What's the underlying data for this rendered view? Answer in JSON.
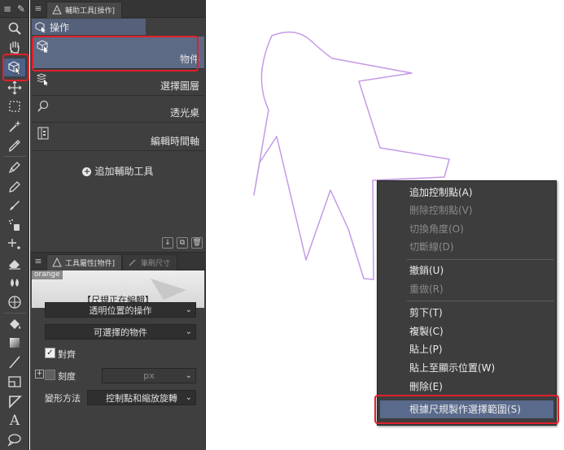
{
  "toolbar": {
    "tools": [
      "zoom-icon",
      "hand-icon",
      "operation-icon",
      "move-layer-icon",
      "selection-icon",
      "auto-select-icon",
      "eyedropper-icon",
      "pen-icon",
      "pencil-icon",
      "brush-icon",
      "airbrush-icon",
      "decoration-icon",
      "eraser-icon",
      "blend-icon",
      "figure-icon",
      "fill-icon",
      "gradient-icon",
      "line-icon",
      "frame-border-icon",
      "ruler-icon",
      "text-icon",
      "balloon-icon"
    ],
    "active_tool": "operation-icon"
  },
  "subtool_panel": {
    "tab_label": "輔助工具[操作]",
    "group_label": "操作",
    "items": [
      {
        "label": "物件",
        "icon": "object-cursor-icon",
        "selected": true
      },
      {
        "label": "選擇圖層",
        "icon": "select-layer-icon",
        "selected": false
      },
      {
        "label": "透光桌",
        "icon": "light-table-icon",
        "selected": false
      },
      {
        "label": "編輯時間軸",
        "icon": "timeline-icon",
        "selected": false
      }
    ],
    "add_label": "追加輔助工具"
  },
  "tool_property": {
    "tab_label": "工具屬性[物件]",
    "tab2_label": "筆刷尺寸",
    "preview_tag": "orange",
    "status_text": "【尺規正在編輯】",
    "transparent_op": "透明位置的操作",
    "selectable_obj": "可選擇的物件",
    "snap_label": "對齊",
    "scale_label": "刻度",
    "unit": "px",
    "transform_label": "變形方法",
    "transform_value": "控制點和縮放旋轉"
  },
  "context_menu": {
    "items": [
      {
        "label": "追加控制點(A)",
        "enabled": true
      },
      {
        "label": "刪除控制點(V)",
        "enabled": false
      },
      {
        "label": "切換角度(O)",
        "enabled": false
      },
      {
        "label": "切斷線(D)",
        "enabled": false
      },
      {
        "label": "撤銷(U)",
        "enabled": true
      },
      {
        "label": "重做(R)",
        "enabled": false
      },
      {
        "label": "剪下(T)",
        "enabled": true
      },
      {
        "label": "複製(C)",
        "enabled": true
      },
      {
        "label": "貼上(P)",
        "enabled": true
      },
      {
        "label": "貼上至顯示位置(W)",
        "enabled": true
      },
      {
        "label": "刪除(E)",
        "enabled": true
      },
      {
        "label": "根據尺規製作選擇範圍(S)",
        "enabled": true,
        "highlighted": true
      }
    ]
  },
  "colors": {
    "ruler_outline": "#c49ae6",
    "annotation_red": "#e0202a",
    "selection_blue": "#5d6a86"
  }
}
